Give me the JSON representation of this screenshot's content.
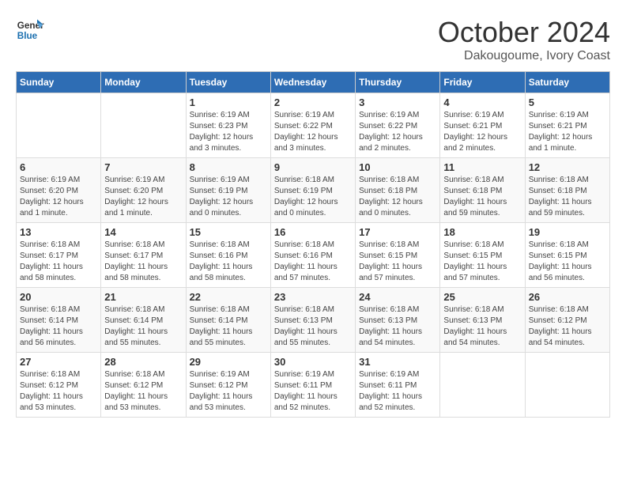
{
  "logo": {
    "line1": "General",
    "line2": "Blue"
  },
  "title": "October 2024",
  "subtitle": "Dakougoume, Ivory Coast",
  "weekdays": [
    "Sunday",
    "Monday",
    "Tuesday",
    "Wednesday",
    "Thursday",
    "Friday",
    "Saturday"
  ],
  "weeks": [
    [
      {
        "day": "",
        "info": ""
      },
      {
        "day": "",
        "info": ""
      },
      {
        "day": "1",
        "info": "Sunrise: 6:19 AM\nSunset: 6:23 PM\nDaylight: 12 hours and 3 minutes."
      },
      {
        "day": "2",
        "info": "Sunrise: 6:19 AM\nSunset: 6:22 PM\nDaylight: 12 hours and 3 minutes."
      },
      {
        "day": "3",
        "info": "Sunrise: 6:19 AM\nSunset: 6:22 PM\nDaylight: 12 hours and 2 minutes."
      },
      {
        "day": "4",
        "info": "Sunrise: 6:19 AM\nSunset: 6:21 PM\nDaylight: 12 hours and 2 minutes."
      },
      {
        "day": "5",
        "info": "Sunrise: 6:19 AM\nSunset: 6:21 PM\nDaylight: 12 hours and 1 minute."
      }
    ],
    [
      {
        "day": "6",
        "info": "Sunrise: 6:19 AM\nSunset: 6:20 PM\nDaylight: 12 hours and 1 minute."
      },
      {
        "day": "7",
        "info": "Sunrise: 6:19 AM\nSunset: 6:20 PM\nDaylight: 12 hours and 1 minute."
      },
      {
        "day": "8",
        "info": "Sunrise: 6:19 AM\nSunset: 6:19 PM\nDaylight: 12 hours and 0 minutes."
      },
      {
        "day": "9",
        "info": "Sunrise: 6:18 AM\nSunset: 6:19 PM\nDaylight: 12 hours and 0 minutes."
      },
      {
        "day": "10",
        "info": "Sunrise: 6:18 AM\nSunset: 6:18 PM\nDaylight: 12 hours and 0 minutes."
      },
      {
        "day": "11",
        "info": "Sunrise: 6:18 AM\nSunset: 6:18 PM\nDaylight: 11 hours and 59 minutes."
      },
      {
        "day": "12",
        "info": "Sunrise: 6:18 AM\nSunset: 6:18 PM\nDaylight: 11 hours and 59 minutes."
      }
    ],
    [
      {
        "day": "13",
        "info": "Sunrise: 6:18 AM\nSunset: 6:17 PM\nDaylight: 11 hours and 58 minutes."
      },
      {
        "day": "14",
        "info": "Sunrise: 6:18 AM\nSunset: 6:17 PM\nDaylight: 11 hours and 58 minutes."
      },
      {
        "day": "15",
        "info": "Sunrise: 6:18 AM\nSunset: 6:16 PM\nDaylight: 11 hours and 58 minutes."
      },
      {
        "day": "16",
        "info": "Sunrise: 6:18 AM\nSunset: 6:16 PM\nDaylight: 11 hours and 57 minutes."
      },
      {
        "day": "17",
        "info": "Sunrise: 6:18 AM\nSunset: 6:15 PM\nDaylight: 11 hours and 57 minutes."
      },
      {
        "day": "18",
        "info": "Sunrise: 6:18 AM\nSunset: 6:15 PM\nDaylight: 11 hours and 57 minutes."
      },
      {
        "day": "19",
        "info": "Sunrise: 6:18 AM\nSunset: 6:15 PM\nDaylight: 11 hours and 56 minutes."
      }
    ],
    [
      {
        "day": "20",
        "info": "Sunrise: 6:18 AM\nSunset: 6:14 PM\nDaylight: 11 hours and 56 minutes."
      },
      {
        "day": "21",
        "info": "Sunrise: 6:18 AM\nSunset: 6:14 PM\nDaylight: 11 hours and 55 minutes."
      },
      {
        "day": "22",
        "info": "Sunrise: 6:18 AM\nSunset: 6:14 PM\nDaylight: 11 hours and 55 minutes."
      },
      {
        "day": "23",
        "info": "Sunrise: 6:18 AM\nSunset: 6:13 PM\nDaylight: 11 hours and 55 minutes."
      },
      {
        "day": "24",
        "info": "Sunrise: 6:18 AM\nSunset: 6:13 PM\nDaylight: 11 hours and 54 minutes."
      },
      {
        "day": "25",
        "info": "Sunrise: 6:18 AM\nSunset: 6:13 PM\nDaylight: 11 hours and 54 minutes."
      },
      {
        "day": "26",
        "info": "Sunrise: 6:18 AM\nSunset: 6:12 PM\nDaylight: 11 hours and 54 minutes."
      }
    ],
    [
      {
        "day": "27",
        "info": "Sunrise: 6:18 AM\nSunset: 6:12 PM\nDaylight: 11 hours and 53 minutes."
      },
      {
        "day": "28",
        "info": "Sunrise: 6:18 AM\nSunset: 6:12 PM\nDaylight: 11 hours and 53 minutes."
      },
      {
        "day": "29",
        "info": "Sunrise: 6:19 AM\nSunset: 6:12 PM\nDaylight: 11 hours and 53 minutes."
      },
      {
        "day": "30",
        "info": "Sunrise: 6:19 AM\nSunset: 6:11 PM\nDaylight: 11 hours and 52 minutes."
      },
      {
        "day": "31",
        "info": "Sunrise: 6:19 AM\nSunset: 6:11 PM\nDaylight: 11 hours and 52 minutes."
      },
      {
        "day": "",
        "info": ""
      },
      {
        "day": "",
        "info": ""
      }
    ]
  ]
}
